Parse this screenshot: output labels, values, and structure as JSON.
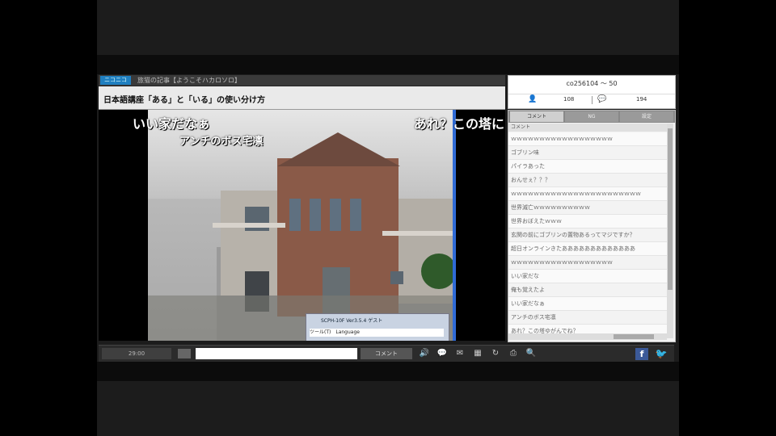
{
  "header": {
    "live_badge": "ニコニコ",
    "page_title": "旅猫の記事【ようこそハカロソロ】",
    "video_title": "日本語講座「ある」と「いる」の使い分け方"
  },
  "video": {
    "danmaku": [
      "いい家だなぁ",
      "アンチのボス宅凛",
      "あれ？この塔に"
    ],
    "window_caption_title": "SCPH-10F Ver3.5.4 ゲスト",
    "window_caption_sub": "ツール(T)　Language"
  },
  "controls": {
    "time": "29:00",
    "comment_input_placeholder": "",
    "comment_button": "コメント"
  },
  "info": {
    "video_id": "co256104 ～ 50",
    "viewer_count": "108",
    "comment_count": "194"
  },
  "comments": {
    "tabs": [
      "コメント",
      "NG",
      "設定"
    ],
    "column_header": "コメント",
    "items": [
      "ｗｗｗｗｗｗｗｗｗｗｗｗｗｗｗｗｗｗ",
      "ゴブリン味",
      "パイラあった",
      "おんせぇ？？？",
      "ｗｗｗｗｗｗｗｗｗｗｗｗｗｗｗｗｗｗｗｗｗｗｗ",
      "世界滅亡ｗｗｗｗｗｗｗｗｗｗ",
      "世界おぼえたｗｗｗ",
      "玄関の前にゴブリンの置物あるってマジですか？",
      "超日オンラインきたあああああああああああああ",
      "ｗｗｗｗｗｗｗｗｗｗｗｗｗｗｗｗｗｗ",
      "いい家だな",
      "俺も覚えたよ",
      "いい家だなぁ",
      "アンチのボス宅凛",
      "あれ？この塔ゆがんでね？"
    ]
  },
  "social": {
    "facebook": "f",
    "twitter": "🐦"
  },
  "colors": {
    "accent": "#1f7fc0",
    "facebook": "#3b5998",
    "twitter": "#55acee"
  }
}
